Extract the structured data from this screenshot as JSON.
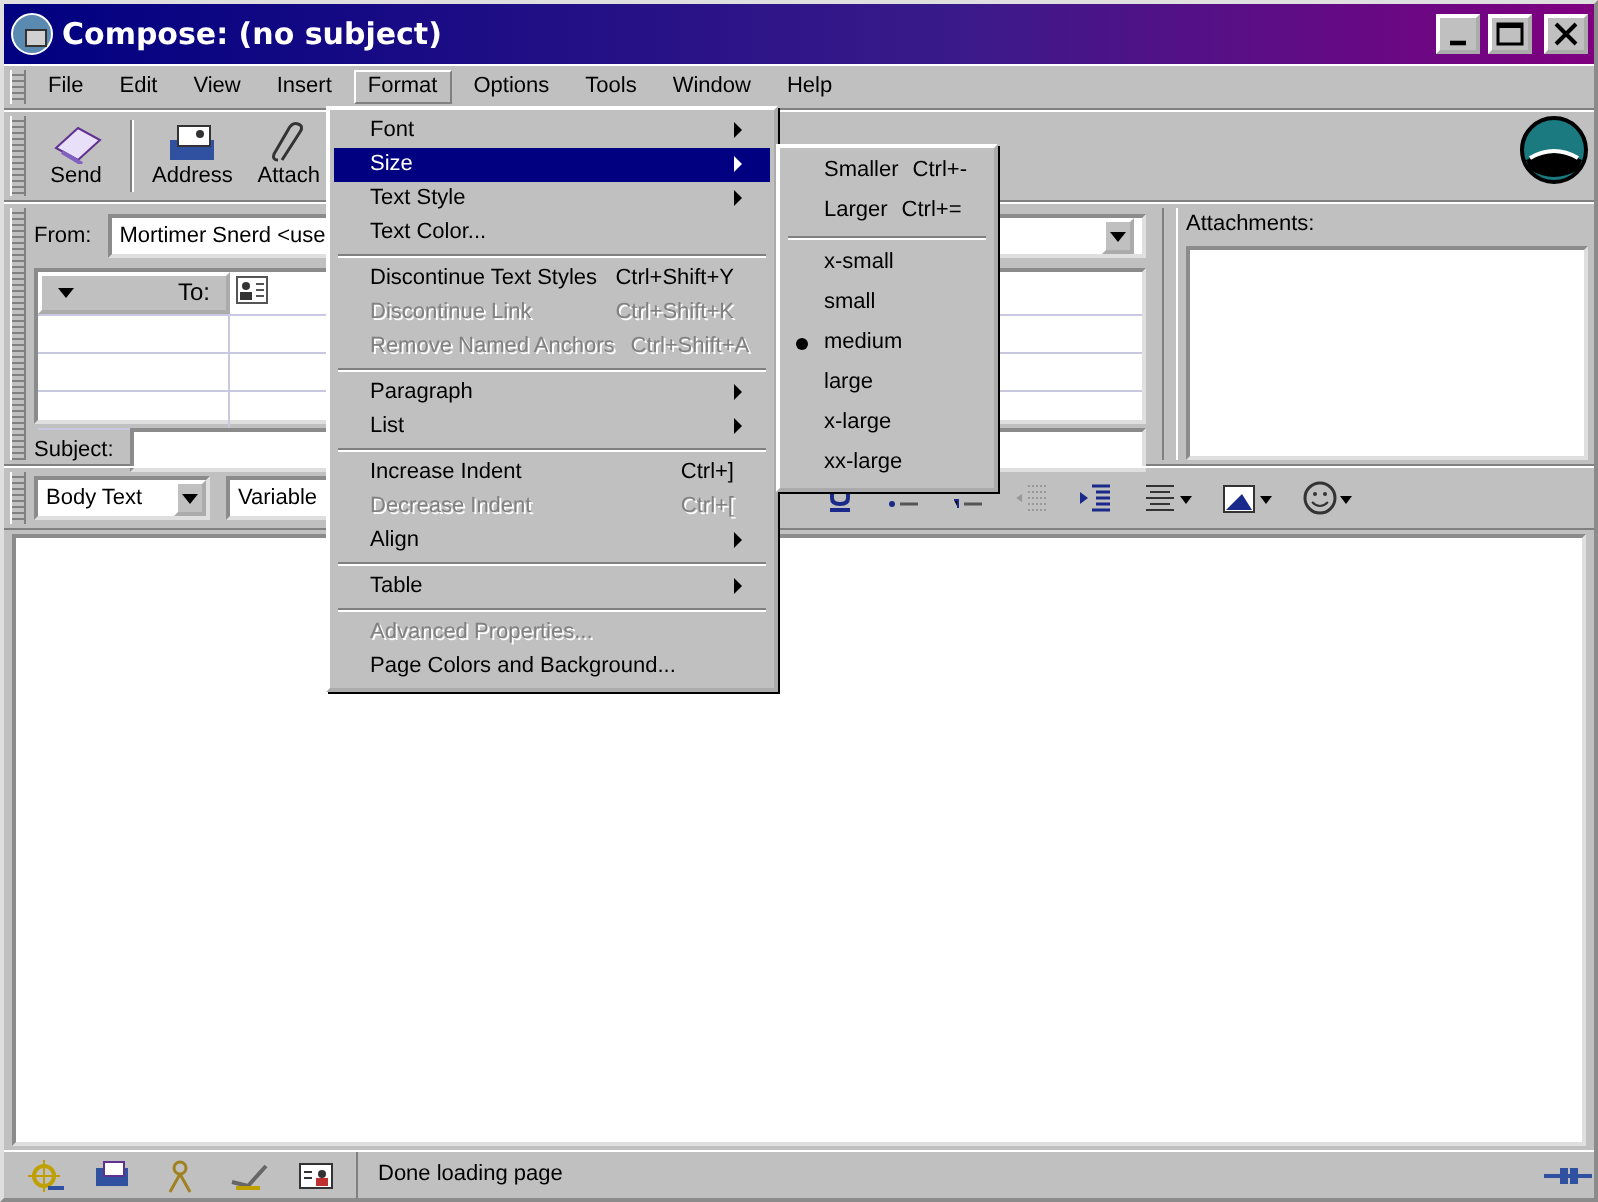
{
  "window": {
    "title": "Compose: (no subject)"
  },
  "menu_bar": [
    {
      "label": "File",
      "selected": false
    },
    {
      "label": "Edit",
      "selected": false
    },
    {
      "label": "View",
      "selected": false
    },
    {
      "label": "Insert",
      "selected": false
    },
    {
      "label": "Format",
      "selected": true
    },
    {
      "label": "Options",
      "selected": false
    },
    {
      "label": "Tools",
      "selected": false
    },
    {
      "label": "Window",
      "selected": false
    },
    {
      "label": "Help",
      "selected": false
    }
  ],
  "toolbar": [
    {
      "label": "Send",
      "kind": "send"
    },
    {
      "label": "Address",
      "kind": "address"
    },
    {
      "label": "Attach",
      "kind": "attach"
    }
  ],
  "from": {
    "label": "From:",
    "value": "Mortimer Snerd <use"
  },
  "recipients": {
    "header": "To:"
  },
  "subject": {
    "label": "Subject:"
  },
  "attachments": {
    "label": "Attachments:"
  },
  "format_toolbar": {
    "paragraph_style": "Body Text",
    "font": "Variable",
    "tools": [
      {
        "kind": "underline"
      },
      {
        "kind": "bullets"
      },
      {
        "kind": "numbers"
      },
      {
        "kind": "outdent"
      },
      {
        "kind": "indent"
      },
      {
        "kind": "align"
      },
      {
        "kind": "image"
      },
      {
        "kind": "smiley"
      }
    ]
  },
  "format_menu": [
    {
      "kind": "item",
      "label": "Font",
      "submenu": true,
      "disabled": false,
      "selected": false
    },
    {
      "kind": "item",
      "label": "Size",
      "submenu": true,
      "disabled": false,
      "selected": true
    },
    {
      "kind": "item",
      "label": "Text Style",
      "submenu": true,
      "disabled": false,
      "selected": false
    },
    {
      "kind": "item",
      "label": "Text Color...",
      "submenu": false,
      "disabled": false,
      "selected": false
    },
    {
      "kind": "separator"
    },
    {
      "kind": "item",
      "label": "Discontinue Text Styles",
      "shortcut": "Ctrl+Shift+Y",
      "submenu": false,
      "disabled": false,
      "selected": false
    },
    {
      "kind": "item",
      "label": "Discontinue Link",
      "shortcut": "Ctrl+Shift+K",
      "submenu": false,
      "disabled": true,
      "selected": false
    },
    {
      "kind": "item",
      "label": "Remove Named Anchors",
      "shortcut": "Ctrl+Shift+A",
      "submenu": false,
      "disabled": true,
      "selected": false
    },
    {
      "kind": "separator"
    },
    {
      "kind": "item",
      "label": "Paragraph",
      "submenu": true,
      "disabled": false,
      "selected": false
    },
    {
      "kind": "item",
      "label": "List",
      "submenu": true,
      "disabled": false,
      "selected": false
    },
    {
      "kind": "separator"
    },
    {
      "kind": "item",
      "label": "Increase Indent",
      "shortcut": "Ctrl+]",
      "submenu": false,
      "disabled": false,
      "selected": false
    },
    {
      "kind": "item",
      "label": "Decrease Indent",
      "shortcut": "Ctrl+[",
      "submenu": false,
      "disabled": true,
      "selected": false
    },
    {
      "kind": "item",
      "label": "Align",
      "submenu": true,
      "disabled": false,
      "selected": false
    },
    {
      "kind": "separator"
    },
    {
      "kind": "item",
      "label": "Table",
      "submenu": true,
      "disabled": false,
      "selected": false
    },
    {
      "kind": "separator"
    },
    {
      "kind": "item",
      "label": "Advanced Properties...",
      "submenu": false,
      "disabled": true,
      "selected": false
    },
    {
      "kind": "item",
      "label": "Page Colors and Background...",
      "submenu": false,
      "disabled": false,
      "selected": false
    }
  ],
  "size_menu": [
    {
      "kind": "item",
      "label": "Smaller",
      "shortcut": "Ctrl+-",
      "checked": false
    },
    {
      "kind": "item",
      "label": "Larger",
      "shortcut": "Ctrl+=",
      "checked": false
    },
    {
      "kind": "separator"
    },
    {
      "kind": "item",
      "label": "x-small",
      "checked": false
    },
    {
      "kind": "item",
      "label": "small",
      "checked": false
    },
    {
      "kind": "item",
      "label": "medium",
      "checked": true
    },
    {
      "kind": "item",
      "label": "large",
      "checked": false
    },
    {
      "kind": "item",
      "label": "x-large",
      "checked": false
    },
    {
      "kind": "item",
      "label": "xx-large",
      "checked": false
    }
  ],
  "status_bar": {
    "text": "Done loading page"
  }
}
